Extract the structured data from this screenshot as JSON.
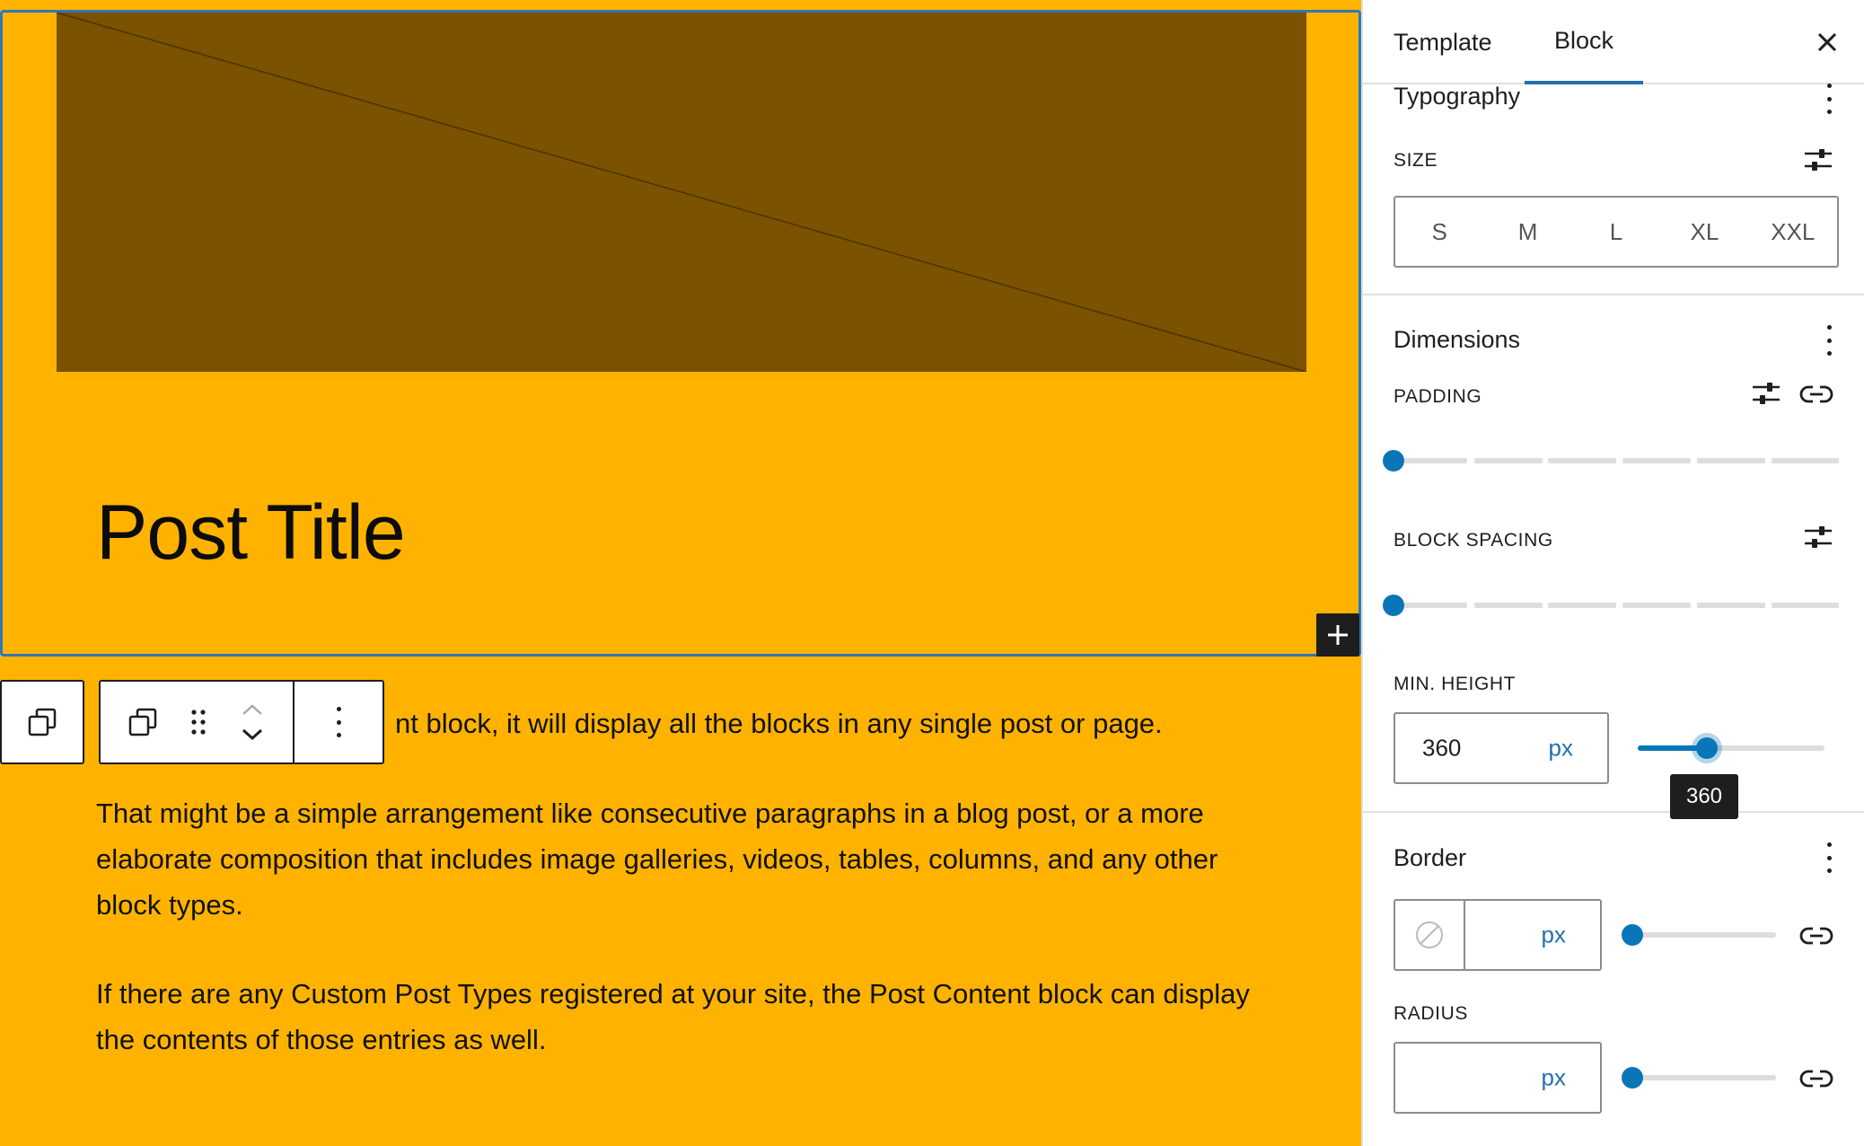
{
  "canvas": {
    "post_title": "Post Title",
    "paragraphs": [
      "nt block, it will display all the blocks in any single post or page.",
      "That might be a simple arrangement like consecutive paragraphs in a blog post, or a more elaborate composition that includes image galleries, videos, tables, columns, and any other block types.",
      "If there are any Custom Post Types registered at your site, the Post Content block can display the contents of those entries as well."
    ],
    "background_color": "#ffb300",
    "image_placeholder_color": "#7a5200"
  },
  "toolbar": {
    "icons": [
      "copy-icon",
      "copy-icon",
      "drag-handle-icon",
      "chevron-up-icon",
      "chevron-down-icon",
      "more-vertical-icon"
    ]
  },
  "sidebar": {
    "tabs": [
      {
        "label": "Template",
        "active": false
      },
      {
        "label": "Block",
        "active": true
      }
    ],
    "typography": {
      "title": "Typography",
      "size_label": "SIZE",
      "size_options": [
        "S",
        "M",
        "L",
        "XL",
        "XXL"
      ]
    },
    "dimensions": {
      "title": "Dimensions",
      "padding_label": "PADDING",
      "block_spacing_label": "BLOCK SPACING",
      "min_height_label": "MIN. HEIGHT",
      "min_height_value": "360",
      "min_height_unit": "px",
      "min_height_tooltip": "360",
      "min_height_slider_fraction": 0.37
    },
    "border": {
      "title": "Border",
      "width_unit": "px",
      "radius_label": "RADIUS",
      "radius_unit": "px"
    },
    "accent_color": "#0a76b8"
  }
}
